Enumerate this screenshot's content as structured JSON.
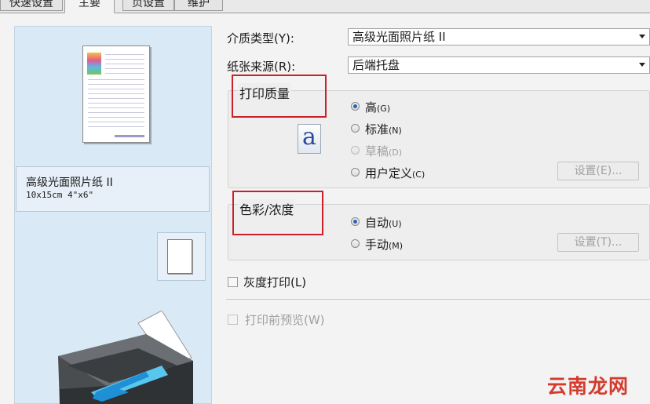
{
  "tabs": [
    "快速设置",
    "主要",
    "页设置",
    "维护"
  ],
  "preview": {
    "media_name": "高级光面照片纸 II",
    "media_size": "10x15cm 4\"x6\""
  },
  "media_type": {
    "label": "介质类型(Y):",
    "value": "高级光面照片纸 II"
  },
  "paper_source": {
    "label": "纸张来源(R):",
    "value": "后端托盘"
  },
  "print_quality": {
    "title": "打印质量",
    "icon": "a",
    "options": [
      {
        "text": "高",
        "key": "(G)",
        "selected": true,
        "disabled": false
      },
      {
        "text": "标准",
        "key": "(N)",
        "selected": false,
        "disabled": false
      },
      {
        "text": "草稿",
        "key": "(D)",
        "selected": false,
        "disabled": true
      },
      {
        "text": "用户定义",
        "key": "(C)",
        "selected": false,
        "disabled": false
      }
    ],
    "settings_button": "设置(E)..."
  },
  "color_intensity": {
    "title": "色彩/浓度",
    "options": [
      {
        "text": "自动",
        "key": "(U)",
        "selected": true
      },
      {
        "text": "手动",
        "key": "(M)",
        "selected": false
      }
    ],
    "settings_button": "设置(T)..."
  },
  "grayscale": {
    "label": "灰度打印(L)",
    "checked": false
  },
  "preview_before_print": {
    "label": "打印前预览(W)",
    "checked": false,
    "disabled": true
  },
  "watermark": "云南龙网"
}
